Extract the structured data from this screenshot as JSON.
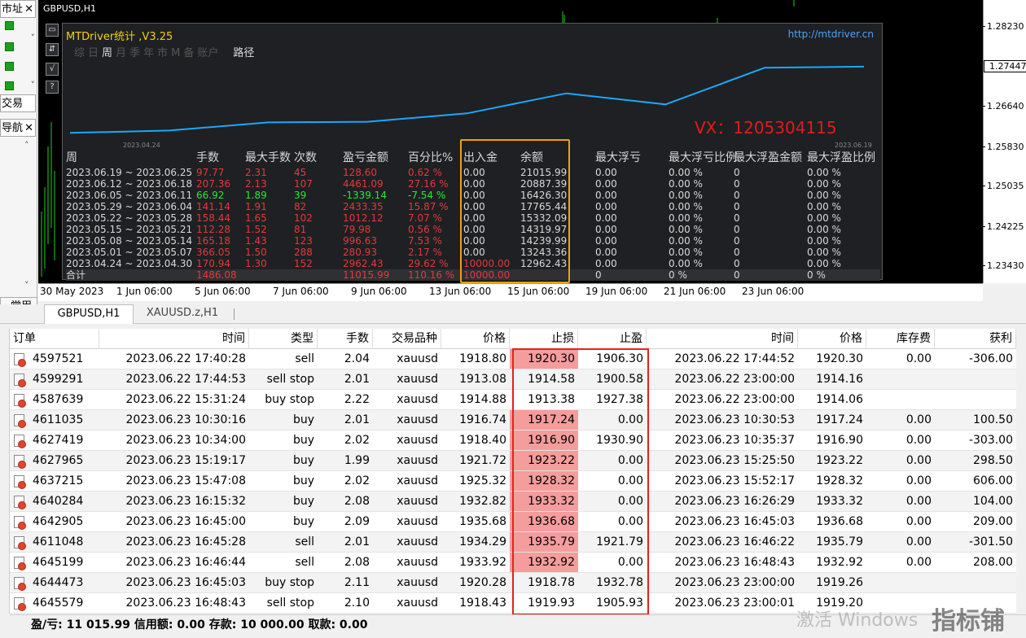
{
  "window": {
    "symbol_title": "GBPUSD,H1"
  },
  "sidebar": {
    "tab_market": "市址",
    "tab_trade": "交易",
    "tab_nav": "导航",
    "close": "✕",
    "common_btn": "常用"
  },
  "chart": {
    "price_labels": [
      "1.28230",
      "1.27447",
      "1.26640",
      "1.25830",
      "1.25035",
      "1.24225",
      "1.23430"
    ],
    "current_price": "1.27447",
    "time_labels": [
      "30 May 2023",
      "1 Jun 06:00",
      "5 Jun 06:00",
      "7 Jun 06:00",
      "9 Jun 06:00",
      "13 Jun 06:00",
      "15 Jun 06:00",
      "19 Jun 06:00",
      "21 Jun 06:00",
      "23 Jun 06:00"
    ]
  },
  "panel": {
    "title": "MTDriver统计 ,V3.25",
    "link": "http://mtdriver.cn",
    "tabs": [
      "综",
      "日",
      "周",
      "月",
      "季",
      "年",
      "市",
      "M",
      "备",
      "账户"
    ],
    "active_tab": "周",
    "path_label": "路径",
    "side_buttons": [
      "▭",
      "⇵",
      "√",
      "?"
    ],
    "watermark_vx": "VX：1205304115",
    "curve_start_date": "2023.04.24",
    "curve_end_date": "2023.06.19",
    "headers": [
      "周",
      "手数",
      "最大手数",
      "次数",
      "盈亏金额",
      "百分比%",
      "出入金",
      "余额",
      "最大浮亏",
      "最大浮亏比例",
      "最大浮盈金额",
      "最大浮盈比例"
    ],
    "rows": [
      {
        "week": "2023.06.19 ~ 2023.06.25",
        "lots": "97.77",
        "maxlots": "2.31",
        "count": "45",
        "pnl": "128.60",
        "pct": "0.62 %",
        "io": "0.00",
        "bal": "21015.99",
        "mfl": "0.00",
        "mflp": "0.00 %",
        "mfp": "0",
        "mfpp": "0.00 %",
        "color": "red"
      },
      {
        "week": "2023.06.12 ~ 2023.06.18",
        "lots": "207.36",
        "maxlots": "2.13",
        "count": "107",
        "pnl": "4461.09",
        "pct": "27.16 %",
        "io": "0.00",
        "bal": "20887.39",
        "mfl": "0.00",
        "mflp": "0.00 %",
        "mfp": "0",
        "mfpp": "0.00 %",
        "color": "red"
      },
      {
        "week": "2023.06.05 ~ 2023.06.11",
        "lots": "66.92",
        "maxlots": "1.89",
        "count": "39",
        "pnl": "-1339.14",
        "pct": "-7.54 %",
        "io": "0.00",
        "bal": "16426.30",
        "mfl": "0.00",
        "mflp": "0.00 %",
        "mfp": "0",
        "mfpp": "0.00 %",
        "color": "grn"
      },
      {
        "week": "2023.05.29 ~ 2023.06.04",
        "lots": "141.14",
        "maxlots": "1.91",
        "count": "82",
        "pnl": "2433.35",
        "pct": "15.87 %",
        "io": "0.00",
        "bal": "17765.44",
        "mfl": "0.00",
        "mflp": "0.00 %",
        "mfp": "0",
        "mfpp": "0.00 %",
        "color": "red"
      },
      {
        "week": "2023.05.22 ~ 2023.05.28",
        "lots": "158.44",
        "maxlots": "1.65",
        "count": "102",
        "pnl": "1012.12",
        "pct": "7.07 %",
        "io": "0.00",
        "bal": "15332.09",
        "mfl": "0.00",
        "mflp": "0.00 %",
        "mfp": "0",
        "mfpp": "0.00 %",
        "color": "red"
      },
      {
        "week": "2023.05.15 ~ 2023.05.21",
        "lots": "112.28",
        "maxlots": "1.52",
        "count": "81",
        "pnl": "79.98",
        "pct": "0.56 %",
        "io": "0.00",
        "bal": "14319.97",
        "mfl": "0.00",
        "mflp": "0.00 %",
        "mfp": "0",
        "mfpp": "0.00 %",
        "color": "red"
      },
      {
        "week": "2023.05.08 ~ 2023.05.14",
        "lots": "165.18",
        "maxlots": "1.43",
        "count": "123",
        "pnl": "996.63",
        "pct": "7.53 %",
        "io": "0.00",
        "bal": "14239.99",
        "mfl": "0.00",
        "mflp": "0.00 %",
        "mfp": "0",
        "mfpp": "0.00 %",
        "color": "red"
      },
      {
        "week": "2023.05.01 ~ 2023.05.07",
        "lots": "366.05",
        "maxlots": "1.50",
        "count": "288",
        "pnl": "280.93",
        "pct": "2.17 %",
        "io": "0.00",
        "bal": "13243.36",
        "mfl": "0.00",
        "mflp": "0.00 %",
        "mfp": "0",
        "mfpp": "0.00 %",
        "color": "red"
      },
      {
        "week": "2023.04.24 ~ 2023.04.30",
        "lots": "170.94",
        "maxlots": "1.30",
        "count": "152",
        "pnl": "2962.43",
        "pct": "29.62 %",
        "io": "10000.00",
        "bal": "12962.43",
        "mfl": "0.00",
        "mflp": "0.00 %",
        "mfp": "0",
        "mfpp": "0.00 %",
        "color": "red"
      }
    ],
    "total": {
      "week": "合计",
      "lots": "1486.08",
      "pnl": "11015.99",
      "pct": "110.16 %",
      "io": "10000.00",
      "mfl": "0",
      "mflp": "0 %",
      "mfp": "0",
      "mfpp": "0 %"
    }
  },
  "chart_tabs": {
    "active": "GBPUSD,H1",
    "other": "XAUUSD.z,H1"
  },
  "table": {
    "headers": [
      "订单",
      "时间",
      "类型",
      "手数",
      "交易品种",
      "价格",
      "止损",
      "止盈",
      "时间",
      "价格",
      "库存费",
      "获利"
    ],
    "rows": [
      [
        "4597521",
        "2023.06.22 17:40:28",
        "sell",
        "2.04",
        "xauusd",
        "1918.80",
        "1920.30",
        "1906.30",
        "2023.06.22 17:44:52",
        "1920.30",
        "0.00",
        "-306.00"
      ],
      [
        "4599291",
        "2023.06.22 17:44:53",
        "sell stop",
        "2.01",
        "xauusd",
        "1913.08",
        "1914.58",
        "1900.58",
        "2023.06.22 23:00:00",
        "1914.16",
        "",
        ""
      ],
      [
        "4587639",
        "2023.06.22 15:31:24",
        "buy stop",
        "2.22",
        "xauusd",
        "1914.88",
        "1913.38",
        "1927.38",
        "2023.06.22 23:00:00",
        "1914.06",
        "",
        ""
      ],
      [
        "4611035",
        "2023.06.23 10:30:16",
        "buy",
        "2.01",
        "xauusd",
        "1916.74",
        "1917.24",
        "0.00",
        "2023.06.23 10:30:53",
        "1917.24",
        "0.00",
        "100.50"
      ],
      [
        "4627419",
        "2023.06.23 10:34:00",
        "buy",
        "2.02",
        "xauusd",
        "1918.40",
        "1916.90",
        "1930.90",
        "2023.06.23 10:35:37",
        "1916.90",
        "0.00",
        "-303.00"
      ],
      [
        "4627965",
        "2023.06.23 15:19:17",
        "buy",
        "1.99",
        "xauusd",
        "1921.72",
        "1923.22",
        "0.00",
        "2023.06.23 15:25:50",
        "1923.22",
        "0.00",
        "298.50"
      ],
      [
        "4637215",
        "2023.06.23 15:47:08",
        "buy",
        "2.02",
        "xauusd",
        "1925.32",
        "1928.32",
        "0.00",
        "2023.06.23 15:52:17",
        "1928.32",
        "0.00",
        "606.00"
      ],
      [
        "4640284",
        "2023.06.23 16:15:32",
        "buy",
        "2.08",
        "xauusd",
        "1932.82",
        "1933.32",
        "0.00",
        "2023.06.23 16:26:29",
        "1933.32",
        "0.00",
        "104.00"
      ],
      [
        "4642905",
        "2023.06.23 16:45:00",
        "buy",
        "2.09",
        "xauusd",
        "1935.68",
        "1936.68",
        "0.00",
        "2023.06.23 16:45:03",
        "1936.68",
        "0.00",
        "209.00"
      ],
      [
        "4611048",
        "2023.06.23 16:45:28",
        "sell",
        "2.01",
        "xauusd",
        "1934.29",
        "1935.79",
        "1921.79",
        "2023.06.23 16:46:22",
        "1935.79",
        "0.00",
        "-301.50"
      ],
      [
        "4645199",
        "2023.06.23 16:46:44",
        "sell",
        "2.08",
        "xauusd",
        "1933.92",
        "1932.92",
        "0.00",
        "2023.06.23 16:48:43",
        "1932.92",
        "0.00",
        "208.00"
      ],
      [
        "4644473",
        "2023.06.23 16:45:03",
        "buy stop",
        "2.11",
        "xauusd",
        "1920.28",
        "1918.78",
        "1932.78",
        "2023.06.23 23:00:00",
        "1919.26",
        "",
        ""
      ],
      [
        "4645579",
        "2023.06.23 16:48:43",
        "sell stop",
        "2.10",
        "xauusd",
        "1918.43",
        "1919.93",
        "1905.93",
        "2023.06.23 23:00:01",
        "1919.20",
        "",
        ""
      ]
    ],
    "pink_sl_rows": [
      0,
      3,
      4,
      5,
      6,
      7,
      8,
      9,
      10
    ]
  },
  "status": {
    "text": "盈/亏: 11 015.99  信用额: 0.00  存款: 10 000.00  取款: 0.00"
  },
  "watermark": {
    "activate": "激活 Windows",
    "brand": "指标铺"
  },
  "colors": {
    "panel_bg": "#1e2023",
    "curve": "#1aa8ff",
    "loss_red": "#e5383b",
    "gain_green": "#2ee82e",
    "highlight_orange": "#f1a10a",
    "highlight_red": "#e2231a",
    "sl_pink": "#f59c9c"
  }
}
